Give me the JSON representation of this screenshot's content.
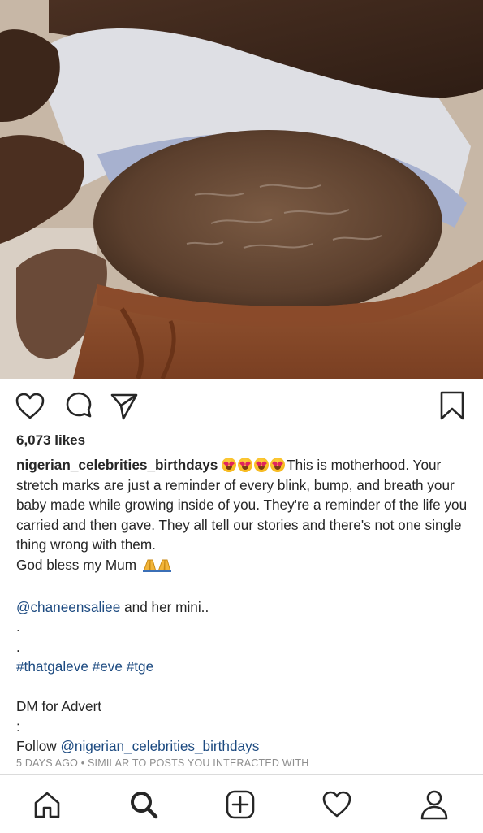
{
  "post": {
    "likes": "6,073 likes",
    "username": "nigerian_celebrities_birthdays",
    "caption_main": "This is motherhood. Your stretch marks are just a reminder of every blink, bump, and breath your baby made while growing inside of you. They're a reminder of the life you carried and then gave. They all tell our stories and there's not one single thing wrong with them.",
    "caption_bless": "God bless my Mum",
    "mention_1": "@chaneensaliee",
    "mention_1_suffix": " and her mini..",
    "dot_1": ".",
    "dot_2": ".",
    "hashtags": "#thatgaleve #eve #tge",
    "dm_line": "DM for Advert",
    "colon_line": ":",
    "follow_prefix": "Follow ",
    "mention_2": "@nigerian_celebrities_birthdays",
    "meta": "5 DAYS AGO • SIMILAR TO POSTS YOU INTERACTED WITH"
  },
  "icons": {
    "like": "heart-icon",
    "comment": "comment-icon",
    "share": "send-icon",
    "save": "bookmark-icon",
    "home": "home-icon",
    "search": "search-icon",
    "new_post": "add-post-icon",
    "activity": "heart-icon",
    "profile": "profile-icon"
  },
  "colors": {
    "text": "#262626",
    "link": "#1c4a80",
    "muted": "#8e8e8e",
    "divider": "#dbdbdb"
  }
}
